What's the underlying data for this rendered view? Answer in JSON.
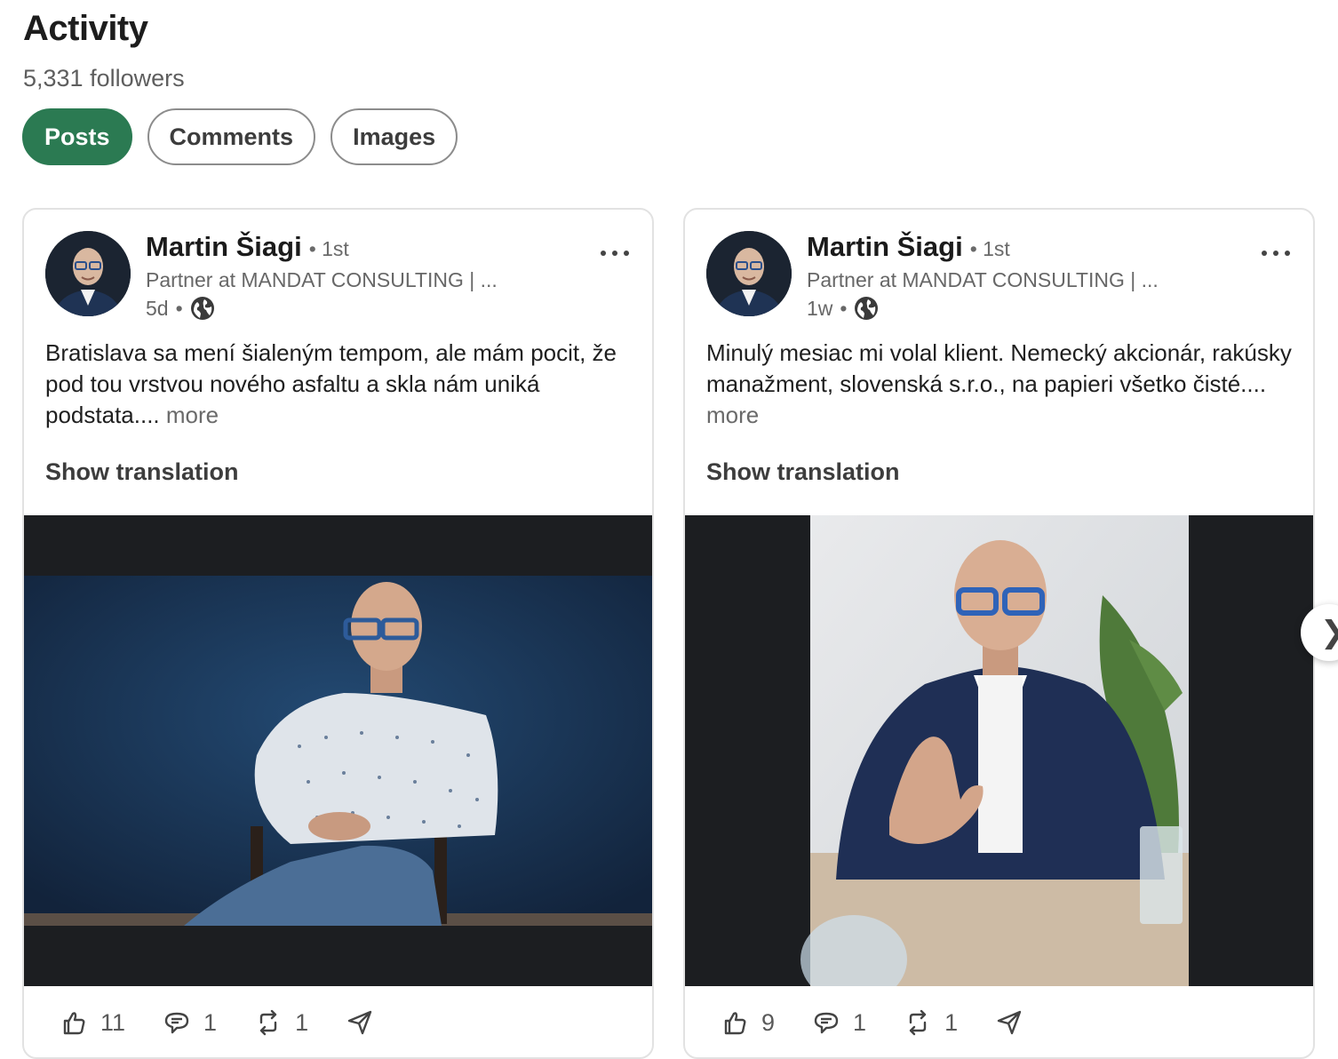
{
  "header": {
    "title": "Activity",
    "followers": "5,331 followers"
  },
  "filters": [
    "Posts",
    "Comments",
    "Images"
  ],
  "active_filter": "Posts",
  "accent_color": "#2b7a52",
  "posts": [
    {
      "author": "Martin Šiagi",
      "degree": "• 1st",
      "subtitle": "Partner at MANDAT CONSULTING | ...",
      "time": "5d",
      "visibility_icon": "globe-icon",
      "text": "Bratislava sa mení šialeným tempom, ale mám pocit, že pod tou vrstvou nového asfaltu a skla nám uniká podstata....",
      "more_label": "more",
      "translate_label": "Show translation",
      "reactions": "11",
      "comments": "1",
      "reposts": "1"
    },
    {
      "author": "Martin Šiagi",
      "degree": "• 1st",
      "subtitle": "Partner at MANDAT CONSULTING | ...",
      "time": "1w",
      "visibility_icon": "globe-icon",
      "text": "Minulý mesiac mi volal klient. Nemecký akcionár, rakúsky manažment, slovenská s.r.o., na papieri všetko čisté....",
      "more_label": "more",
      "translate_label": "Show translation",
      "reactions": "9",
      "comments": "1",
      "reposts": "1"
    }
  ],
  "carousel_next_icon": "chevron-right-icon",
  "next_glyph": "❯"
}
